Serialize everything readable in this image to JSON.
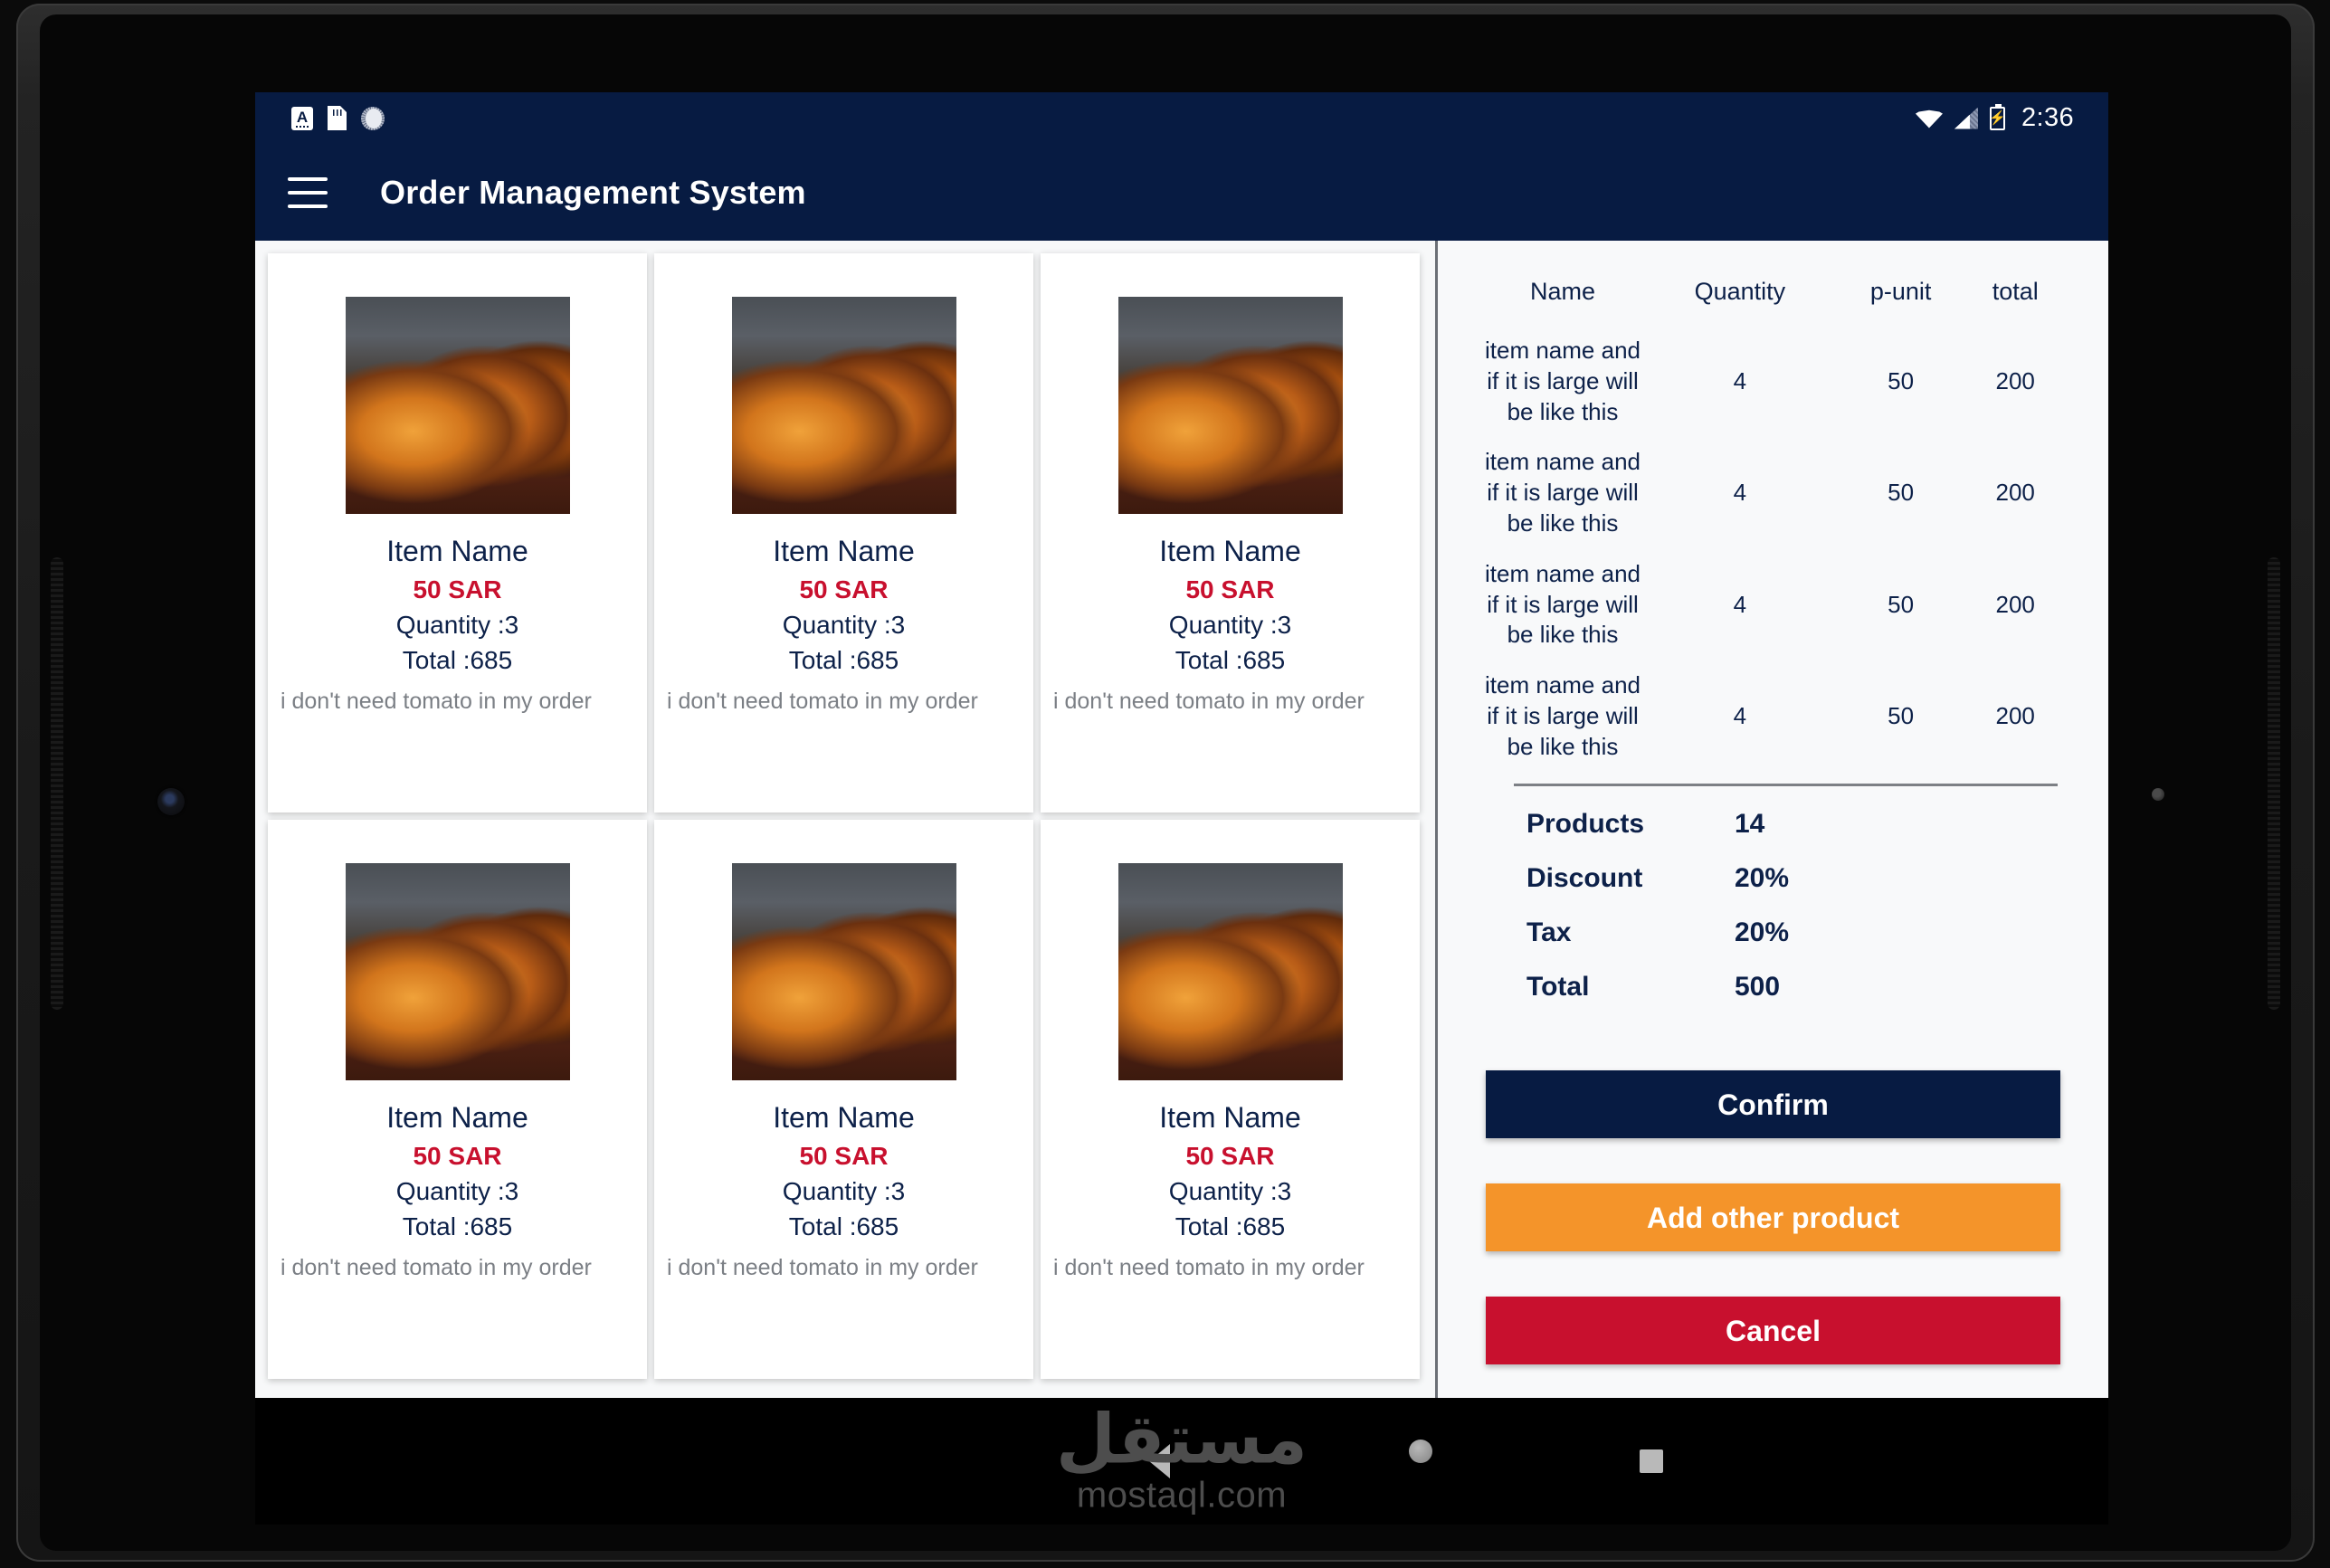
{
  "status_bar": {
    "icons_left": [
      "letter-a-badge-icon",
      "sd-card-icon",
      "sync-circle-icon"
    ],
    "icons_right": [
      "wifi-icon",
      "cell-signal-icon",
      "battery-charging-icon"
    ],
    "time": "2:36"
  },
  "app_bar": {
    "menu_icon": "hamburger-menu-icon",
    "title": "Order Management System"
  },
  "products": [
    {
      "name": "Item Name",
      "price": "50 SAR",
      "quantity": "Quantity :3",
      "total": "Total :685",
      "note": "i don't need tomato in my order"
    },
    {
      "name": "Item Name",
      "price": "50 SAR",
      "quantity": "Quantity :3",
      "total": "Total :685",
      "note": "i don't need tomato in my order"
    },
    {
      "name": "Item Name",
      "price": "50 SAR",
      "quantity": "Quantity :3",
      "total": "Total :685",
      "note": "i don't need tomato in my order"
    },
    {
      "name": "Item Name",
      "price": "50 SAR",
      "quantity": "Quantity :3",
      "total": "Total :685",
      "note": "i don't need tomato in my order"
    },
    {
      "name": "Item Name",
      "price": "50 SAR",
      "quantity": "Quantity :3",
      "total": "Total :685",
      "note": "i don't need tomato in my order"
    },
    {
      "name": "Item Name",
      "price": "50 SAR",
      "quantity": "Quantity :3",
      "total": "Total :685",
      "note": "i don't need tomato in my order"
    }
  ],
  "summary": {
    "columns": [
      "Name",
      "Quantity",
      "p-unit",
      "total"
    ],
    "rows": [
      {
        "name": "item name and if it is large will be like this",
        "quantity": "4",
        "punit": "50",
        "total": "200"
      },
      {
        "name": "item name and if it is large will be like this",
        "quantity": "4",
        "punit": "50",
        "total": "200"
      },
      {
        "name": "item name and if it is large will be like this",
        "quantity": "4",
        "punit": "50",
        "total": "200"
      },
      {
        "name": "item name and if it is large will be like this",
        "quantity": "4",
        "punit": "50",
        "total": "200"
      }
    ],
    "totals": [
      {
        "label": "Products",
        "value": "14"
      },
      {
        "label": "Discount",
        "value": "20%"
      },
      {
        "label": "Tax",
        "value": "20%"
      },
      {
        "label": "Total",
        "value": "500"
      }
    ],
    "buttons": {
      "confirm": "Confirm",
      "add_other": "Add other product",
      "cancel": "Cancel"
    }
  },
  "nav_bar": {
    "back_icon": "back-triangle-icon",
    "home_icon": "home-circle-icon",
    "recents_icon": "recents-square-icon"
  },
  "watermark": {
    "arabic": "مستقل",
    "latin": "mostaql.com"
  },
  "colors": {
    "navy": "#071b42",
    "red": "#c8102e",
    "orange": "#f4942a",
    "screen_bg": "#f7f8f9"
  }
}
